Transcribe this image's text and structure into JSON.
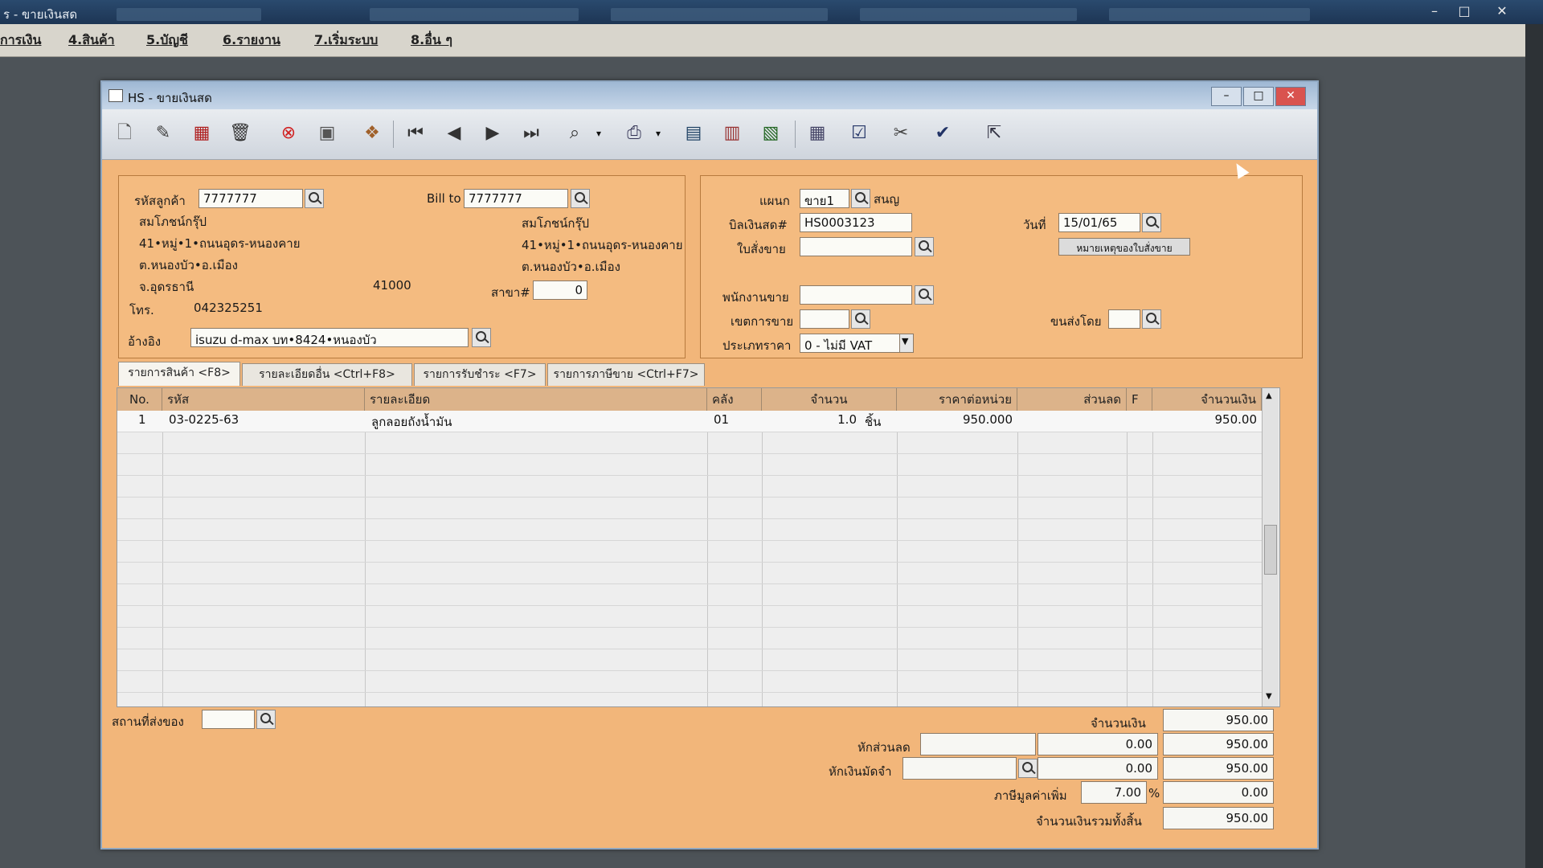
{
  "app": {
    "title": "ร - ขายเงินสด",
    "menu": [
      "การเงิน",
      "4.สินค้า",
      "5.บัญชี",
      "6.รายงาน",
      "7.เริ่มระบบ",
      "8.อื่น ๆ"
    ]
  },
  "window": {
    "title": "HS - ขายเงินสด"
  },
  "customer": {
    "code_label": "รหัสลูกค้า",
    "code": "7777777",
    "name": "สมโภชน์กรุ๊ป",
    "addr1": "41•หมู่•1•ถนนอุดร-หนองคาย",
    "addr2": "ต.หนองบัว•อ.เมือง",
    "addr3": "จ.อุดรธานี",
    "zip": "41000",
    "phone_label": "โทร.",
    "phone": "042325251",
    "ref_label": "อ้างอิง",
    "ref": "isuzu d-max บท•8424•หนองบัว"
  },
  "billto": {
    "label": "Bill to",
    "code": "7777777",
    "name": "สมโภชน์กรุ๊ป",
    "addr1": "41•หมู่•1•ถนนอุดร-หนองคาย",
    "addr2": "ต.หนองบัว•อ.เมือง",
    "branch_label": "สาขา#",
    "branch": "0"
  },
  "doc": {
    "dept_label": "แผนก",
    "dept": "ขาย1",
    "dept_name": "สนญ",
    "bill_label": "บิลเงินสด#",
    "bill": "HS0003123",
    "date_label": "วันที่",
    "date": "15/01/65",
    "so_label": "ใบสั่งขาย",
    "so_note_button": "หมายเหตุของใบสั่งขาย",
    "salesman_label": "พนักงานขาย",
    "area_label": "เขตการขาย",
    "ship_by_label": "ขนส่งโดย",
    "price_type_label": "ประเภทราคา",
    "price_type": "0 - ไม่มี VAT"
  },
  "tabs": [
    "รายการสินค้า <F8>",
    "รายละเอียดอื่น <Ctrl+F8>",
    "รายการรับชำระ <F7>",
    "รายการภาษีขาย <Ctrl+F7>"
  ],
  "grid": {
    "headers": [
      "No.",
      "รหัส",
      "รายละเอียด",
      "คลัง",
      "จำนวน",
      "ราคาต่อหน่วย",
      "ส่วนลด",
      "F",
      "จำนวนเงิน"
    ],
    "rows": [
      {
        "no": "1",
        "code": "03-0225-63",
        "desc": "ลูกลอยถังน้ำมัน",
        "wh": "01",
        "qty": "1.0",
        "unit": "ชิ้น",
        "price": "950.000",
        "disc": "",
        "f": "",
        "amount": "950.00"
      }
    ]
  },
  "footer": {
    "ship_place_label": "สถานที่ส่งของ",
    "amount_label": "จำนวนเงิน",
    "amount": "950.00",
    "discount_label": "หักส่วนลด",
    "discount": "0.00",
    "after_discount": "950.00",
    "deposit_label": "หักเงินมัดจำ",
    "deposit": "0.00",
    "after_deposit": "950.00",
    "vat_label": "ภาษีมูลค่าเพิ่ม",
    "vat_rate": "7.00",
    "vat_pct": "%",
    "vat_amount": "0.00",
    "total_label": "จำนวนเงินรวมทั้งสิ้น",
    "total": "950.00"
  },
  "colors": {
    "window_bg": "#f2b67a",
    "grid_header": "#dcb38a",
    "title_bar": "#9fb8d4"
  }
}
